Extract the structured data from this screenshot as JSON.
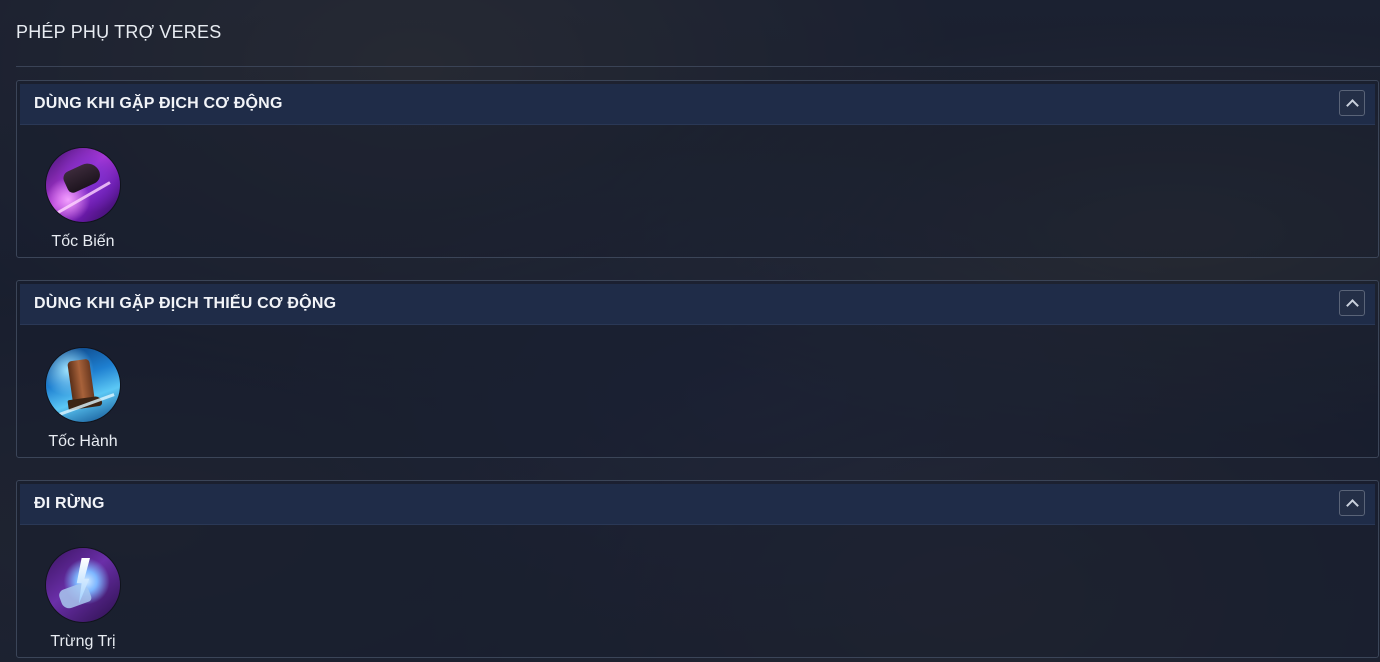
{
  "page": {
    "title": "PHÉP PHỤ TRỢ VERES"
  },
  "sections": [
    {
      "title": "DÙNG KHI GẶP ĐỊCH CƠ ĐỘNG",
      "spell": {
        "name": "Tốc Biến",
        "icon": "flash-icon"
      }
    },
    {
      "title": "DÙNG KHI GẶP ĐỊCH THIẾU CƠ ĐỘNG",
      "spell": {
        "name": "Tốc Hành",
        "icon": "speed-boots-icon"
      }
    },
    {
      "title": "ĐI RỪNG",
      "spell": {
        "name": "Trừng Trị",
        "icon": "punish-icon"
      }
    }
  ],
  "icons": {
    "collapse": "chevron-up-icon"
  }
}
